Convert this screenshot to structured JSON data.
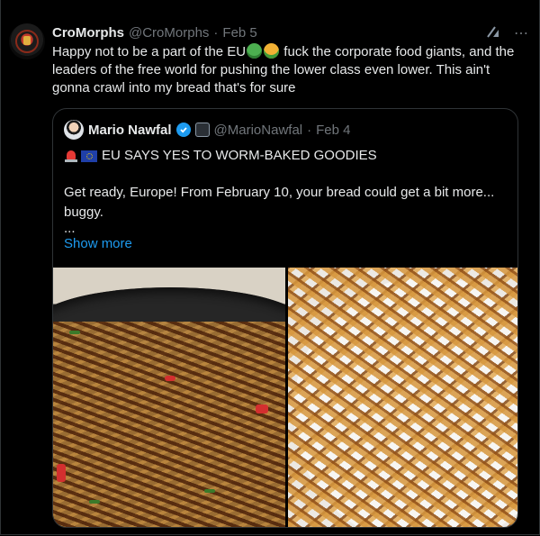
{
  "tweet": {
    "author_name": "CroMorphs",
    "author_handle": "@CroMorphs",
    "separator": "·",
    "date": "Feb 5",
    "text_part1": "Happy not to be a part of the EU",
    "text_part2": " fuck the corporate food giants, and the leaders of the free world for pushing the lower class even lower. This ain't gonna crawl into my bread that's for sure",
    "icons": [
      "grok-icon",
      "more-icon",
      "sick-face-emoji",
      "vomit-face-emoji"
    ]
  },
  "quote": {
    "author_name": "Mario Nawfal",
    "author_handle": "@MarioNawfal",
    "separator": "·",
    "date": "Feb 4",
    "headline": "EU SAYS YES TO WORM-BAKED GOODIES",
    "body": "Get ready, Europe! From February 10, your bread could get a bit more... buggy.",
    "ellipsis": "...",
    "show_more": "Show more",
    "icons": [
      "verified-icon",
      "affiliate-badge-icon",
      "siren-emoji",
      "eu-flag-emoji"
    ]
  },
  "media": [
    {
      "name": "fried-mealworms-wok-image",
      "subject": "fried mealworms in wok with chili and herbs"
    },
    {
      "name": "mealworms-plate-image",
      "subject": "baked mealworms on white plate"
    }
  ],
  "colors": {
    "background": "#000000",
    "text": "#e7e9ea",
    "muted": "#71767b",
    "link": "#1d9bf0",
    "border": "#2f3336"
  }
}
